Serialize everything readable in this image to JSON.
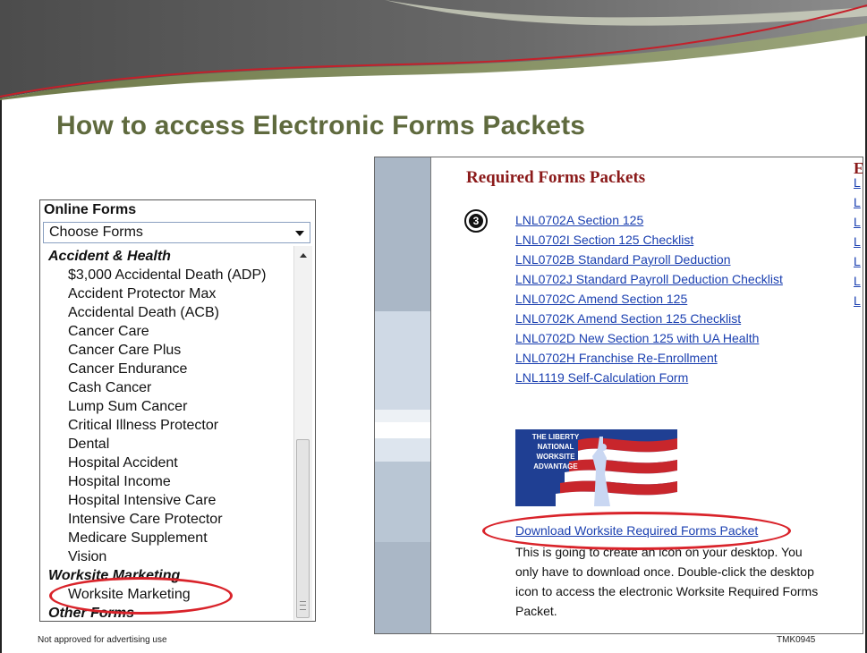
{
  "slide": {
    "title": "How to access Electronic Forms Packets",
    "footer_disclaimer": "Not approved for advertising use",
    "footer_code": "TMK0945"
  },
  "online_forms": {
    "heading": "Online Forms",
    "select_value": "Choose Forms",
    "groups": [
      {
        "label": "Accident & Health",
        "items": [
          "$3,000 Accidental Death (ADP)",
          "Accident Protector Max",
          "Accidental Death (ACB)",
          "Cancer Care",
          "Cancer Care Plus",
          "Cancer Endurance",
          "Cash Cancer",
          "Lump Sum Cancer",
          "Critical Illness Protector",
          "Dental",
          "Hospital Accident",
          "Hospital Income",
          "Hospital Intensive Care",
          "Intensive Care Protector",
          "Medicare Supplement",
          "Vision"
        ]
      },
      {
        "label": "Worksite Marketing",
        "items": [
          "Worksite Marketing"
        ]
      },
      {
        "label": "Other Forms",
        "items": []
      }
    ],
    "highlighted_item": "Worksite Marketing"
  },
  "required_packets": {
    "title": "Required Forms Packets",
    "step_number": "3",
    "links": [
      "LNL0702A Section 125",
      "LNL0702I Section 125 Checklist",
      "LNL0702B Standard Payroll Deduction",
      "LNL0702J Standard Payroll Deduction Checklist",
      "LNL0702C Amend Section 125",
      "LNL0702K Amend Section 125 Checklist",
      "LNL0702D New Section 125 with UA Health",
      "LNL0702H Franchise Re-Enrollment",
      "LNL1119 Self-Calculation Form"
    ],
    "logo": {
      "line1": "THE LIBERTY",
      "line2": "NATIONAL",
      "line3": "WORKSITE",
      "line4": "ADVANTAGE"
    },
    "download_link": "Download Worksite Required Forms Packet",
    "download_desc": "This is going to create an icon on your desktop. You only have to download once. Double-click the desktop icon to access the electronic Worksite Required Forms Packet.",
    "right_column": {
      "heading": "E",
      "links": [
        "L",
        "L",
        "L",
        "L",
        "L",
        "L",
        "L"
      ]
    }
  },
  "colors": {
    "title": "#5f6a3e",
    "accent_red": "#d9232a",
    "link_blue": "#1a3fb0",
    "heading_maroon": "#8b1a1a"
  }
}
